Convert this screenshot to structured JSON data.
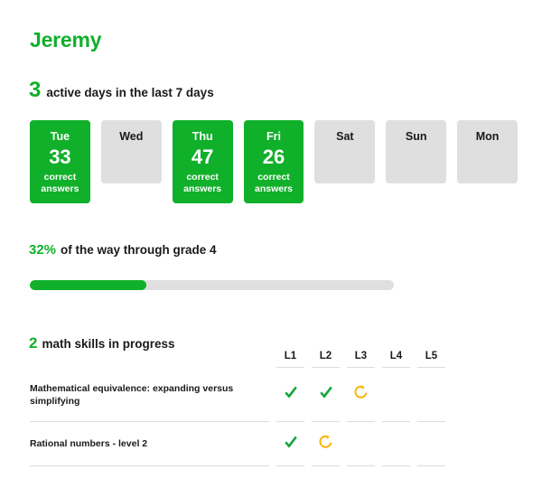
{
  "header": {
    "student_name": "Jeremy",
    "name_color": "#11b02a"
  },
  "streak": {
    "count": "3",
    "label": "active days in the last 7 days"
  },
  "days": {
    "caption": "correct answers",
    "items": [
      {
        "day": "Tue",
        "count": "33",
        "caption_line1": "correct",
        "caption_line2": "answers",
        "active": true
      },
      {
        "day": "Wed",
        "count": "",
        "caption_line1": "",
        "caption_line2": "",
        "active": false
      },
      {
        "day": "Thu",
        "count": "47",
        "caption_line1": "correct",
        "caption_line2": "answers",
        "active": true
      },
      {
        "day": "Fri",
        "count": "26",
        "caption_line1": "correct",
        "caption_line2": "answers",
        "active": true
      },
      {
        "day": "Sat",
        "count": "",
        "caption_line1": "",
        "caption_line2": "",
        "active": false
      },
      {
        "day": "Sun",
        "count": "",
        "caption_line1": "",
        "caption_line2": "",
        "active": false
      },
      {
        "day": "Mon",
        "count": "",
        "caption_line1": "",
        "caption_line2": "",
        "active": false
      }
    ]
  },
  "grade_progress": {
    "percent_label": "32%",
    "percent_value": 32,
    "label": "of the way through grade 4",
    "fill_color": "#11b02a",
    "track_color": "#dfdfe0"
  },
  "skills": {
    "count": "2",
    "label": "math skills in progress",
    "level_headers": [
      "L1",
      "L2",
      "L3",
      "L4",
      "L5"
    ],
    "mastered_color": "#14a53a",
    "in_progress_color": "#f7b500",
    "rows": [
      {
        "name": "Mathematical equivalence: expanding versus simplifying",
        "levels": [
          "mastered",
          "mastered",
          "in-progress",
          "none",
          "none"
        ]
      },
      {
        "name": "Rational numbers - level 2",
        "levels": [
          "mastered",
          "in-progress",
          "none",
          "none",
          "none"
        ]
      }
    ]
  }
}
